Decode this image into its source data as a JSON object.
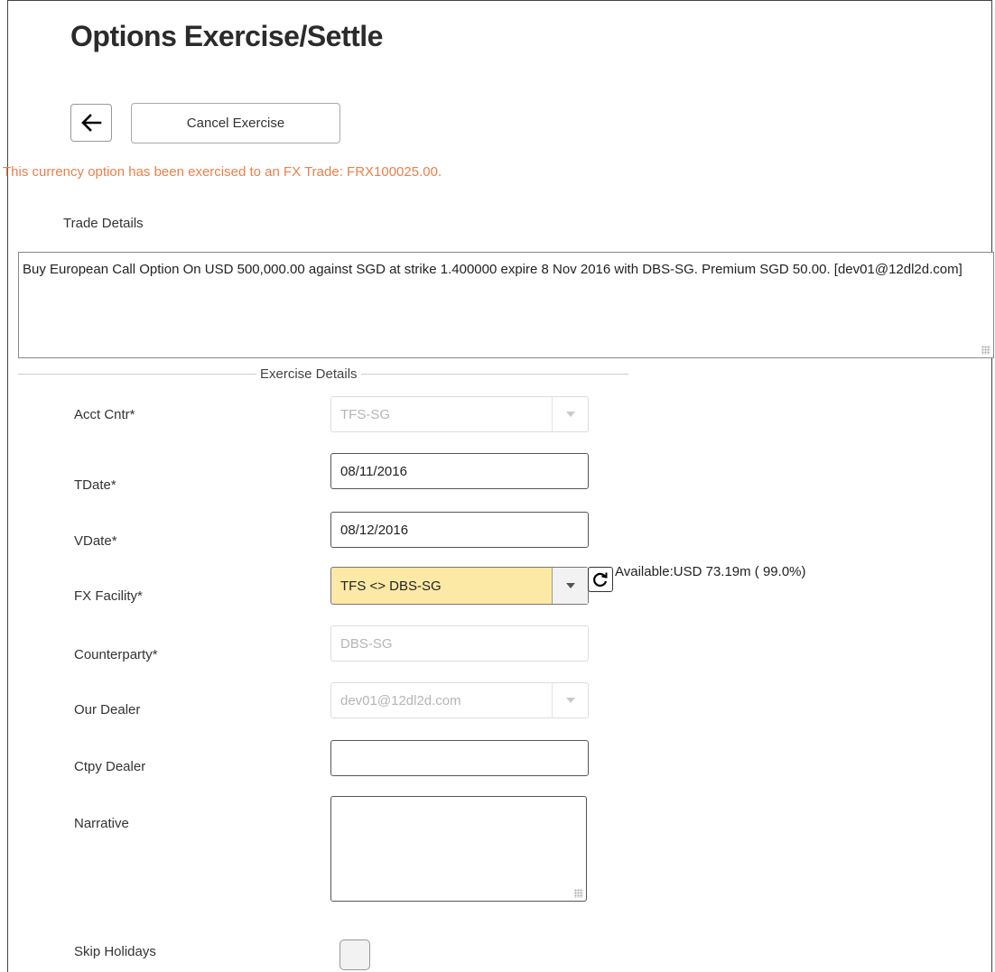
{
  "page": {
    "title": "Options Exercise/Settle"
  },
  "toolbar": {
    "back_icon": "arrow-left-icon",
    "cancel_label": "Cancel Exercise"
  },
  "alert": {
    "message": "This currency option has been exercised to an FX Trade: FRX100025.00.",
    "color": "#e8804a"
  },
  "trade_details": {
    "label": "Trade Details",
    "text": "Buy European Call Option On USD 500,000.00 against SGD at strike 1.400000 expire 8 Nov 2016 with DBS-SG. Premium SGD 50.00. [dev01@12dl2d.com]"
  },
  "exercise_details": {
    "section_label": "Exercise Details",
    "acct_cntr": {
      "label": "Acct Cntr*",
      "value": "TFS-SG"
    },
    "tdate": {
      "label": "TDate*",
      "value": "08/11/2016"
    },
    "vdate": {
      "label": "VDate*",
      "value": "08/12/2016"
    },
    "fx_facility": {
      "label": "FX Facility*",
      "value": "TFS <> DBS-SG",
      "available": "Available:USD 73.19m ( 99.0%)",
      "highlight_color": "#fce9a6"
    },
    "counterparty": {
      "label": "Counterparty*",
      "value": "DBS-SG"
    },
    "our_dealer": {
      "label": "Our Dealer",
      "value": "dev01@12dl2d.com"
    },
    "ctpy_dealer": {
      "label": "Ctpy Dealer",
      "value": ""
    },
    "narrative": {
      "label": "Narrative",
      "value": ""
    },
    "skip_holidays": {
      "label": "Skip Holidays",
      "checked": false
    }
  }
}
